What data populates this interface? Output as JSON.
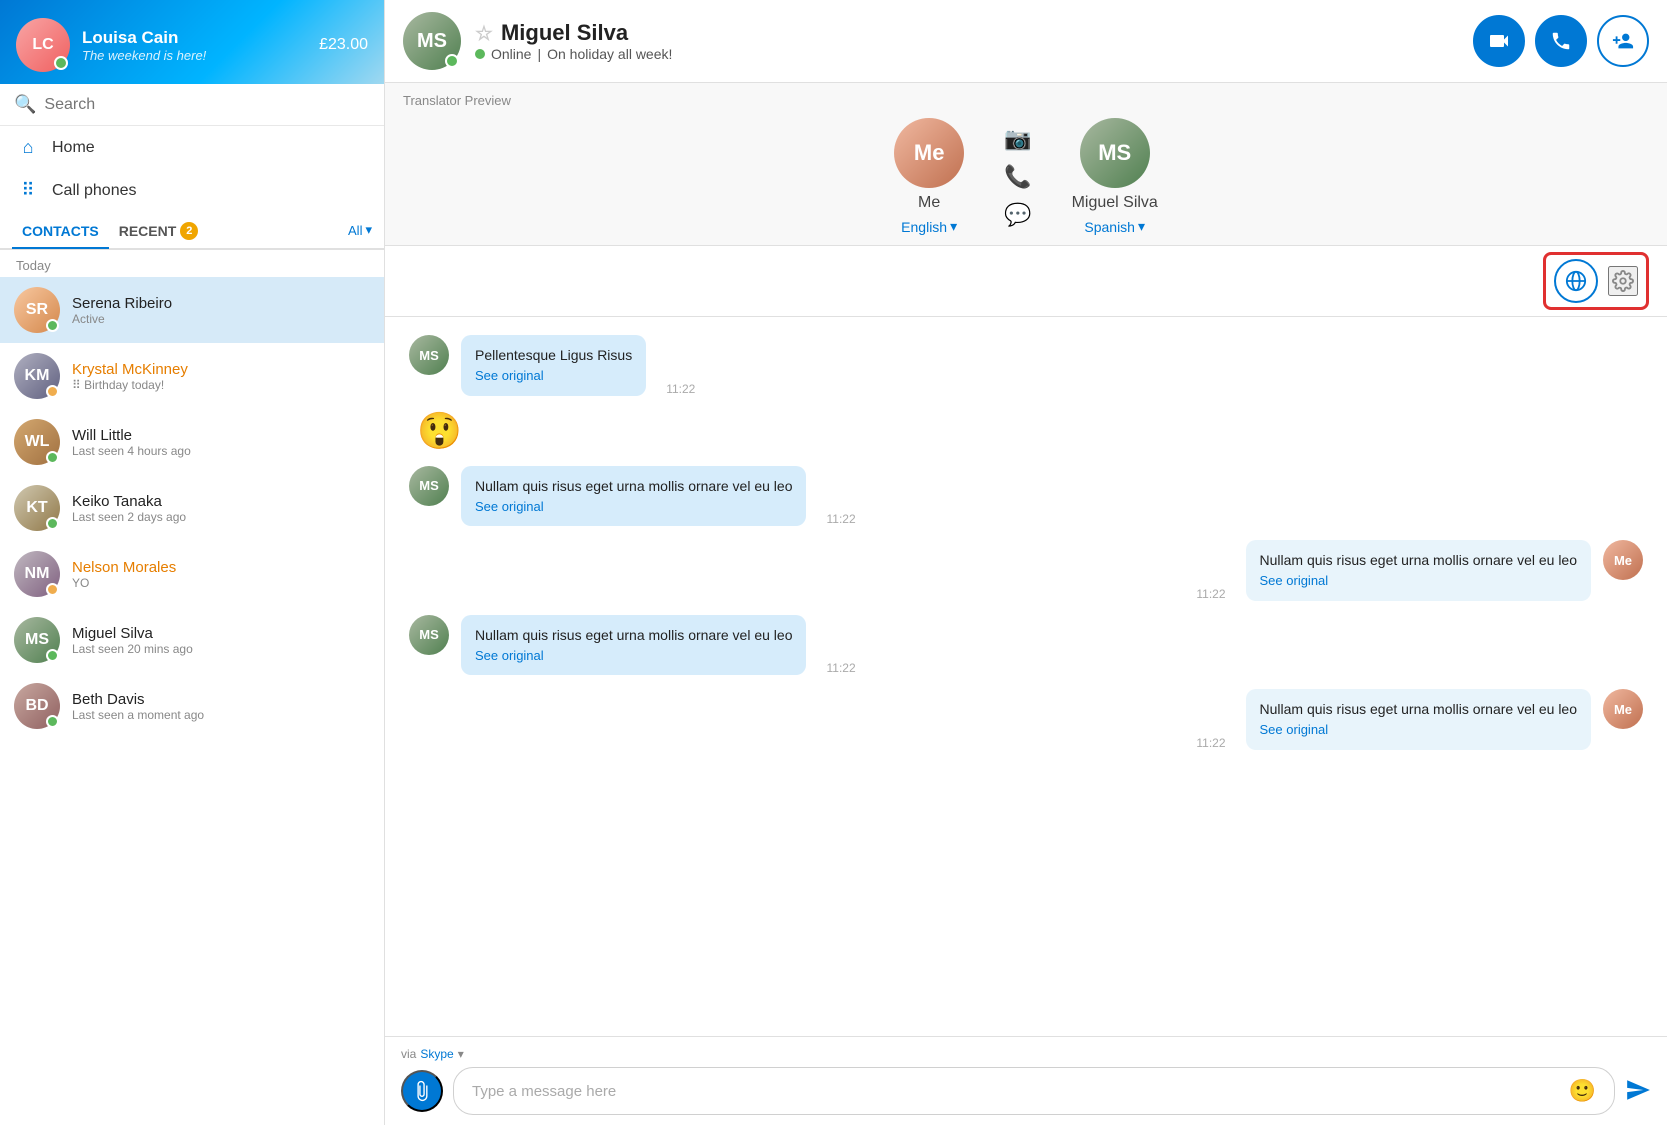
{
  "sidebar": {
    "user": {
      "name": "Louisa Cain",
      "status": "The weekend is here!",
      "balance": "£23.00"
    },
    "search_placeholder": "Search",
    "nav": [
      {
        "id": "home",
        "label": "Home",
        "icon": "⌂"
      },
      {
        "id": "callphones",
        "label": "Call phones",
        "icon": "⠿"
      }
    ],
    "tabs": [
      {
        "id": "contacts",
        "label": "CONTACTS",
        "active": true,
        "badge": null
      },
      {
        "id": "recent",
        "label": "RECENT",
        "active": false,
        "badge": "2"
      }
    ],
    "all_label": "All",
    "section_today": "Today",
    "contacts": [
      {
        "id": "serena",
        "name": "Serena Ribeiro",
        "sub": "Active",
        "av_class": "av-serena",
        "status": "online",
        "active": true,
        "name_class": ""
      },
      {
        "id": "krystal",
        "name": "Krystal McKinney",
        "sub": "Birthday today!",
        "av_class": "av-krystal",
        "status": "away",
        "active": false,
        "name_class": "orange"
      },
      {
        "id": "will",
        "name": "Will Little",
        "sub": "Last seen 4 hours ago",
        "av_class": "av-will",
        "status": "online",
        "active": false,
        "name_class": ""
      },
      {
        "id": "keiko",
        "name": "Keiko Tanaka",
        "sub": "Last seen 2 days ago",
        "av_class": "av-keiko",
        "status": "online",
        "active": false,
        "name_class": ""
      },
      {
        "id": "nelson",
        "name": "Nelson Morales",
        "sub": "YO",
        "av_class": "av-nelson",
        "status": "away",
        "active": false,
        "name_class": "orange"
      },
      {
        "id": "miguel",
        "name": "Miguel Silva",
        "sub": "Last seen 20 mins ago",
        "av_class": "av-miguel2",
        "status": "online",
        "active": false,
        "name_class": ""
      },
      {
        "id": "beth",
        "name": "Beth Davis",
        "sub": "Last seen a moment ago",
        "av_class": "av-beth",
        "status": "online",
        "active": false,
        "name_class": ""
      }
    ]
  },
  "chat": {
    "contact_name": "Miguel Silva",
    "status_text": "Online",
    "status_extra": "On holiday all week!",
    "translator_label": "Translator Preview",
    "me_label": "Me",
    "me_lang": "English",
    "contact_lang": "Spanish",
    "messages": [
      {
        "id": 1,
        "side": "left",
        "text": "Pellentesque Ligus Risus",
        "see_original": "See original",
        "time": "11:22"
      },
      {
        "id": 2,
        "side": "emoji",
        "emoji": "😲"
      },
      {
        "id": 3,
        "side": "left",
        "text": "Nullam quis risus eget urna mollis ornare vel eu leo",
        "see_original": "See original",
        "time": "11:22"
      },
      {
        "id": 4,
        "side": "right",
        "text": "Nullam quis risus eget urna mollis ornare vel eu leo",
        "see_original": "See original",
        "time": "11:22"
      },
      {
        "id": 5,
        "side": "left",
        "text": "Nullam quis risus eget urna mollis ornare vel eu leo",
        "see_original": "See original",
        "time": "11:22"
      },
      {
        "id": 6,
        "side": "right",
        "text": "Nullam quis risus eget urna mollis ornare vel eu leo",
        "see_original": "See original",
        "time": "11:22"
      }
    ],
    "via_label": "via",
    "via_service": "Skype",
    "input_placeholder": "Type a message here"
  }
}
